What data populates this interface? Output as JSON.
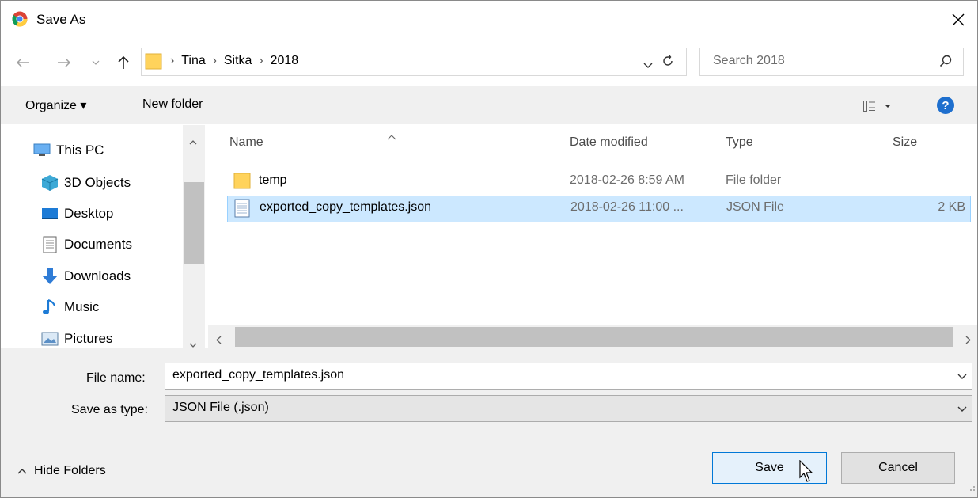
{
  "window": {
    "title": "Save As"
  },
  "nav": {
    "breadcrumb": [
      "Tina",
      "Sitka",
      "2018"
    ],
    "search_placeholder": "Search 2018"
  },
  "toolbar": {
    "organize_label": "Organize ▾",
    "new_folder_label": "New folder"
  },
  "sidebar": {
    "items": [
      {
        "label": "This PC",
        "icon": "computer-icon"
      },
      {
        "label": "3D Objects",
        "icon": "cube-icon"
      },
      {
        "label": "Desktop",
        "icon": "desktop-icon"
      },
      {
        "label": "Documents",
        "icon": "documents-icon"
      },
      {
        "label": "Downloads",
        "icon": "download-icon"
      },
      {
        "label": "Music",
        "icon": "music-icon"
      },
      {
        "label": "Pictures",
        "icon": "pictures-icon"
      }
    ]
  },
  "file_list": {
    "columns": [
      "Name",
      "Date modified",
      "Type",
      "Size"
    ],
    "rows": [
      {
        "name": "temp",
        "date": "2018-02-26 8:59 AM",
        "type": "File folder",
        "size": "",
        "icon": "folder-icon"
      },
      {
        "name": "exported_copy_templates.json",
        "date": "2018-02-26 11:00 ...",
        "type": "JSON File",
        "size": "2 KB",
        "icon": "json-file-icon"
      }
    ]
  },
  "form": {
    "file_name_label": "File name:",
    "file_name_value": "exported_copy_templates.json",
    "save_type_label": "Save as type:",
    "save_type_value": "JSON File (.json)"
  },
  "footer": {
    "hide_folders_label": "Hide Folders",
    "save_label": "Save",
    "cancel_label": "Cancel"
  },
  "colors": {
    "selection": "#cce8ff",
    "accent": "#0078d7",
    "folder": "#ffd35c"
  }
}
